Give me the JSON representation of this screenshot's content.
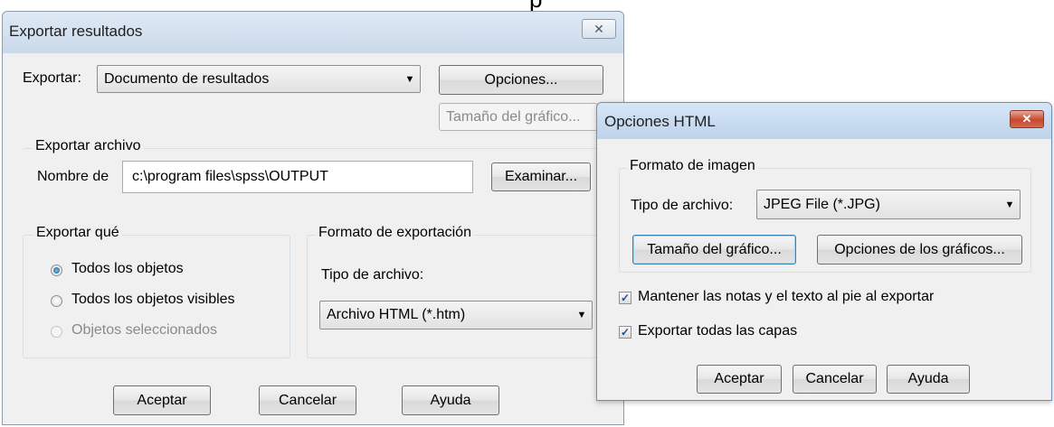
{
  "top_glyph": "p",
  "export_dialog": {
    "title": "Exportar resultados",
    "close_label": "✕",
    "export_label": "Exportar:",
    "export_value": "Documento de resultados",
    "options_button": "Opciones...",
    "chart_size_button": "Tamaño del gráfico...",
    "export_file_group": "Exportar archivo",
    "file_name_label": "Nombre de",
    "file_name_value": "c:\\program files\\spss\\OUTPUT",
    "browse_button": "Examinar...",
    "export_what_group": "Exportar qué",
    "radio_all": "Todos los objetos",
    "radio_visible": "Todos los objetos visibles",
    "radio_selected": "Objetos seleccionados",
    "format_group": "Formato de exportación",
    "file_type_label": "Tipo de archivo:",
    "file_type_value": "Archivo HTML (*.htm)",
    "accept_button": "Aceptar",
    "cancel_button": "Cancelar",
    "help_button": "Ayuda"
  },
  "html_options_dialog": {
    "title": "Opciones HTML",
    "close_label": "✕",
    "image_format_group": "Formato de imagen",
    "file_type_label": "Tipo de archivo:",
    "file_type_value": "JPEG File (*.JPG)",
    "chart_size_button": "Tamaño del gráfico...",
    "chart_options_button": "Opciones de los gráficos...",
    "keep_notes_label": "Mantener las notas y el texto al pie al exportar",
    "export_layers_label": "Exportar todas las capas",
    "accept_button": "Aceptar",
    "cancel_button": "Cancelar",
    "help_button": "Ayuda"
  },
  "icons": {
    "dropdown": "chevron-down-icon",
    "check": "✓"
  },
  "colors": {
    "dialog_bg": "#f0f0f0",
    "title_gradient_start": "#dfe9f5",
    "close_active": "#c9462c"
  }
}
